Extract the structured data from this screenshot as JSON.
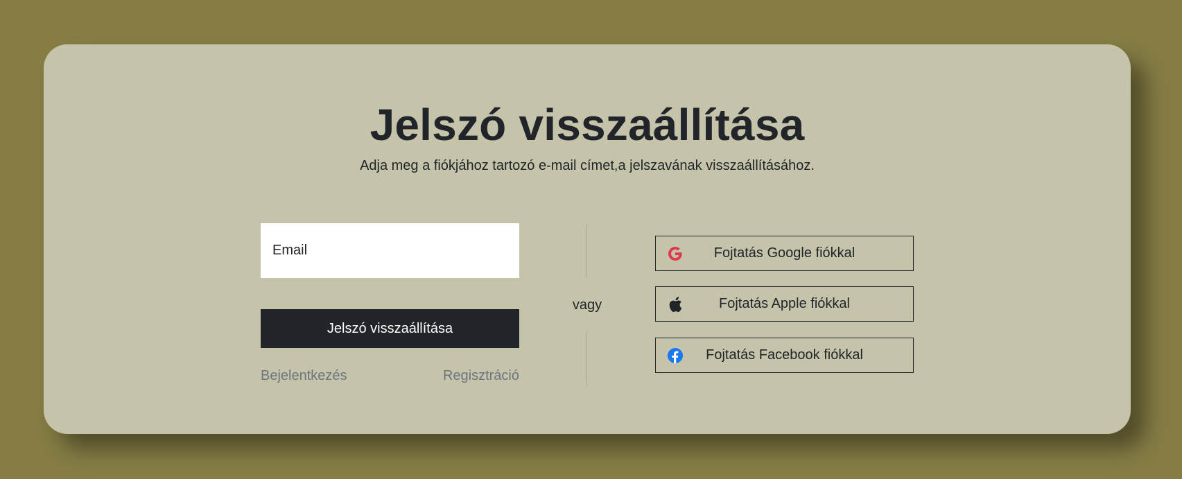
{
  "page": {
    "title": "Jelszó visszaállítása",
    "subtitle": "Adja meg a fiókjához tartozó e-mail címet,a jelszavának visszaállításához."
  },
  "form": {
    "email_placeholder": "Email",
    "email_value": "",
    "submit_label": "Jelszó visszaállítása",
    "login_link": "Bejelentkezés",
    "register_link": "Regisztráció"
  },
  "separator": {
    "label": "vagy"
  },
  "social": {
    "google": {
      "label": "Fojtatás Google fiókkal",
      "icon": "google-icon",
      "color": "#e0394f"
    },
    "apple": {
      "label": "Fojtatás Apple fiókkal",
      "icon": "apple-icon",
      "color": "#212529"
    },
    "facebook": {
      "label": "Fojtatás Facebook fiókkal",
      "icon": "facebook-icon",
      "color": "#1877f2"
    }
  },
  "colors": {
    "background": "#867d45",
    "card": "#c5c4ab",
    "primary_button": "#212529",
    "link": "#6c757d"
  }
}
